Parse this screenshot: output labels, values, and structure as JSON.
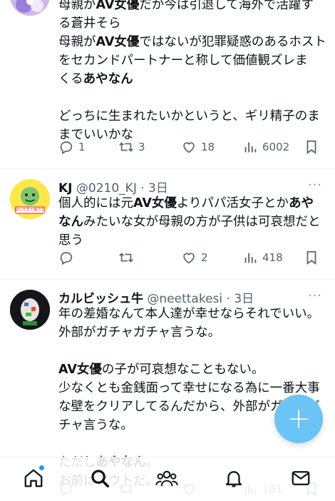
{
  "tweet1": {
    "lines": [
      [
        {
          "t": "母親が"
        },
        {
          "t": "AV女優",
          "b": true
        },
        {
          "t": "だが今は引退して海外で活躍す"
        }
      ],
      [
        {
          "t": "る蒼井そら"
        }
      ],
      [
        {
          "t": "母親が"
        },
        {
          "t": "AV女優",
          "b": true
        },
        {
          "t": "ではないが犯罪疑惑のあるホスト"
        }
      ],
      [
        {
          "t": "をセカンドパートナーと称して価値観ズレま"
        }
      ],
      [
        {
          "t": "くる"
        },
        {
          "t": "あやなん",
          "b": true
        }
      ],
      [
        {
          "t": ""
        }
      ],
      [
        {
          "t": "どっちに生まれたいかというと、ギリ精子のま"
        }
      ],
      [
        {
          "t": "までいいかな"
        }
      ]
    ],
    "reply_count": "1",
    "retweet_count": "3",
    "like_count": "18",
    "view_count": "6002"
  },
  "tweet2": {
    "name": "KJ",
    "handle": "@0210_KJ",
    "time": "· 3日",
    "more": "···",
    "avatar_text": "ぼくが五十嵐です",
    "lines": [
      [
        {
          "t": "個人的には元"
        },
        {
          "t": "AV女優",
          "b": true
        },
        {
          "t": "よりパパ活女子とか"
        },
        {
          "t": "あや",
          "b": true
        }
      ],
      [
        {
          "t": "なん",
          "b": true
        },
        {
          "t": "みたいな女が母親の方が子供は可哀想だと"
        }
      ],
      [
        {
          "t": "思う"
        }
      ]
    ],
    "reply_count": "",
    "retweet_count": "",
    "like_count": "2",
    "view_count": "418"
  },
  "tweet3": {
    "name": "カルビッシュ牛",
    "handle": "@neettakesi",
    "time": "· 3日",
    "more": "···",
    "lines": [
      [
        {
          "t": "年の差婚なんて本人達が幸せならそれでいい。"
        }
      ],
      [
        {
          "t": "外部がガチャガチャ言うな。"
        }
      ],
      [
        {
          "t": ""
        }
      ],
      [
        {
          "t": "AV女優",
          "b": true
        },
        {
          "t": "の子が可哀想なこともない。"
        }
      ],
      [
        {
          "t": "少なくとも金銭面って幸せになる為に一番大事"
        }
      ],
      [
        {
          "t": "な壁をクリアしてるんだから、外部がガチャガ"
        }
      ],
      [
        {
          "t": "チャ言うな。"
        }
      ],
      [
        {
          "t": ""
        }
      ],
      [
        {
          "t": "ただし"
        },
        {
          "t": "あやなん",
          "b": true
        },
        {
          "t": "。"
        }
      ],
      [
        {
          "t": "お前はアウトだ。"
        }
      ]
    ],
    "view_count": "101"
  },
  "fab": {
    "label": "+"
  },
  "nav": [
    "home-icon",
    "search-icon",
    "communities-icon",
    "notifications-icon",
    "messages-icon"
  ],
  "colors": {
    "accent": "#1d9bf0",
    "fab": "#6cc3f5",
    "text": "#0f1419",
    "muted": "#536471"
  }
}
